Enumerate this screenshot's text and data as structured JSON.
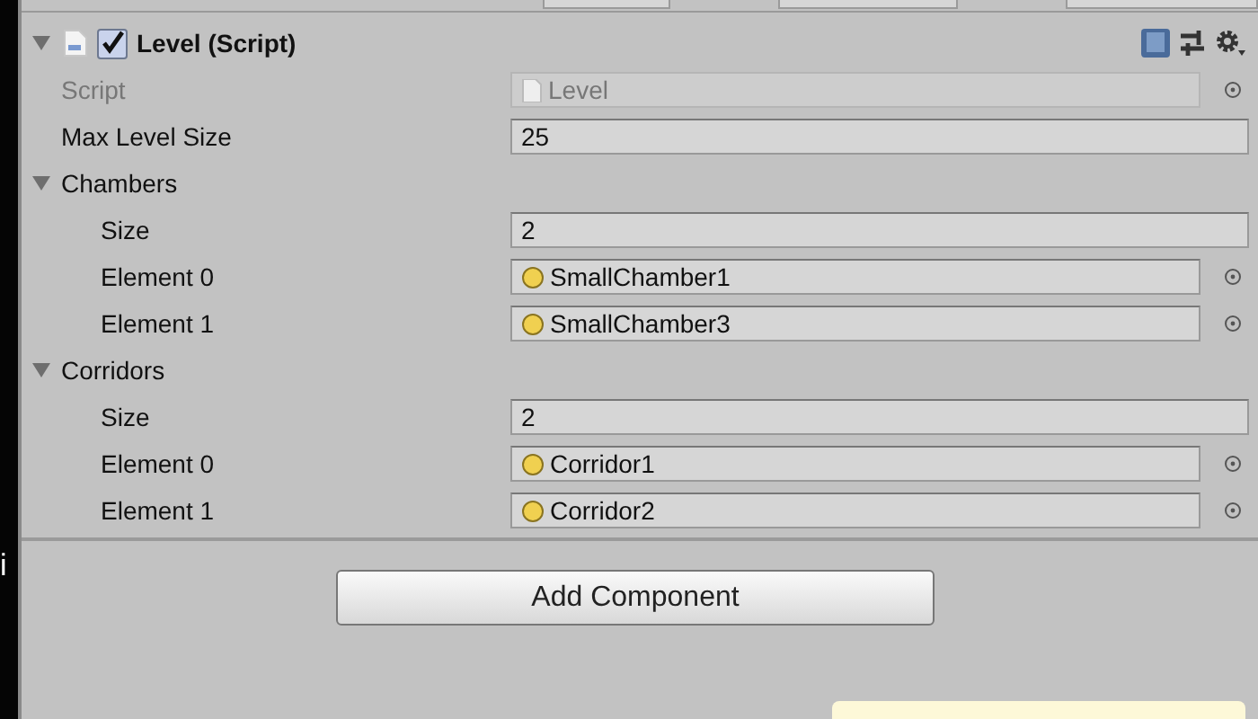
{
  "edge_text": "i",
  "component": {
    "title": "Level (Script)",
    "enabled": true,
    "expanded": true
  },
  "properties": [
    {
      "kind": "script",
      "label": "Script",
      "value": "Level",
      "disabled": true
    },
    {
      "kind": "value",
      "label": "Max Level Size",
      "value": "25"
    },
    {
      "kind": "foldout",
      "label": "Chambers",
      "expanded": true,
      "children": [
        {
          "kind": "value",
          "label": "Size",
          "value": "2"
        },
        {
          "kind": "object",
          "label": "Element 0",
          "value": "SmallChamber1"
        },
        {
          "kind": "object",
          "label": "Element 1",
          "value": "SmallChamber3"
        }
      ]
    },
    {
      "kind": "foldout",
      "label": "Corridors",
      "expanded": true,
      "children": [
        {
          "kind": "value",
          "label": "Size",
          "value": "2"
        },
        {
          "kind": "object",
          "label": "Element 0",
          "value": "Corridor1"
        },
        {
          "kind": "object",
          "label": "Element 1",
          "value": "Corridor2"
        }
      ]
    }
  ],
  "add_button": "Add Component"
}
